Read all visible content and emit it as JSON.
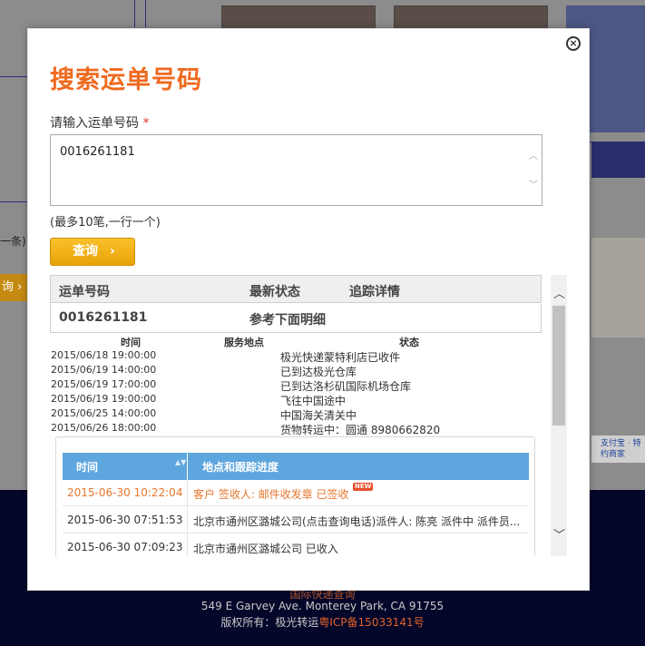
{
  "modal": {
    "title": "搜索运单号码",
    "close_label": "×",
    "input_label": "请输入运单号码",
    "required_mark": "*",
    "input_value": "0016261181",
    "hint": "(最多10笔,一行一个)",
    "search_button": "查询",
    "search_chevron": "›"
  },
  "results": {
    "headers": [
      "运单号码",
      "最新状态",
      "追踪详情"
    ],
    "row": {
      "number": "0016261181",
      "status": "参考下面明细"
    },
    "detail_headers": [
      "时间",
      "服务地点",
      "状态"
    ],
    "details": [
      {
        "time": "2015/06/18 19:00:00",
        "status": "极光快递蒙特利店已收件"
      },
      {
        "time": "2015/06/19 14:00:00",
        "status": "已到达极光仓库"
      },
      {
        "time": "2015/06/19 17:00:00",
        "status": "已到达洛杉矶国际机场仓库"
      },
      {
        "time": "2015/06/19 19:00:00",
        "status": "飞往中国途中"
      },
      {
        "time": "2015/06/25 14:00:00",
        "status": "中国海关清关中"
      },
      {
        "time": "2015/06/26 18:00:00",
        "status": "货物转运中：圆通 8980662820"
      }
    ],
    "tracking_headers": {
      "time": "时间",
      "sort_icon": "▲▼",
      "progress": "地点和跟踪进度"
    },
    "tracking": [
      {
        "time": "2015-06-30 10:22:04",
        "progress": "客户 签收人: 邮件收发章 已签收",
        "badge": "NEW"
      },
      {
        "time": "2015-06-30 07:51:53",
        "progress": "北京市通州区潞城公司(点击查询电话)派件人: 陈亮 派件中 派件员..."
      },
      {
        "time": "2015-06-30 07:09:23",
        "progress": "北京市通州区潞城公司 已收入"
      }
    ]
  },
  "background": {
    "left_text": "一条)",
    "left_button": "询 ›",
    "alipay_text": "支付宝 · 特约商家",
    "footer": {
      "line1": "国际快递查询",
      "line2": "549 E Garvey Ave. Monterey Park, CA 91755",
      "line3_prefix": "版权所有：极光转运",
      "line3_icp": "粤ICP备15033141号"
    }
  },
  "colors": {
    "title": "#ef6a1f",
    "button": "#f2b01a",
    "table_header": "#5ea6de",
    "latest_row": "#e8772e"
  }
}
